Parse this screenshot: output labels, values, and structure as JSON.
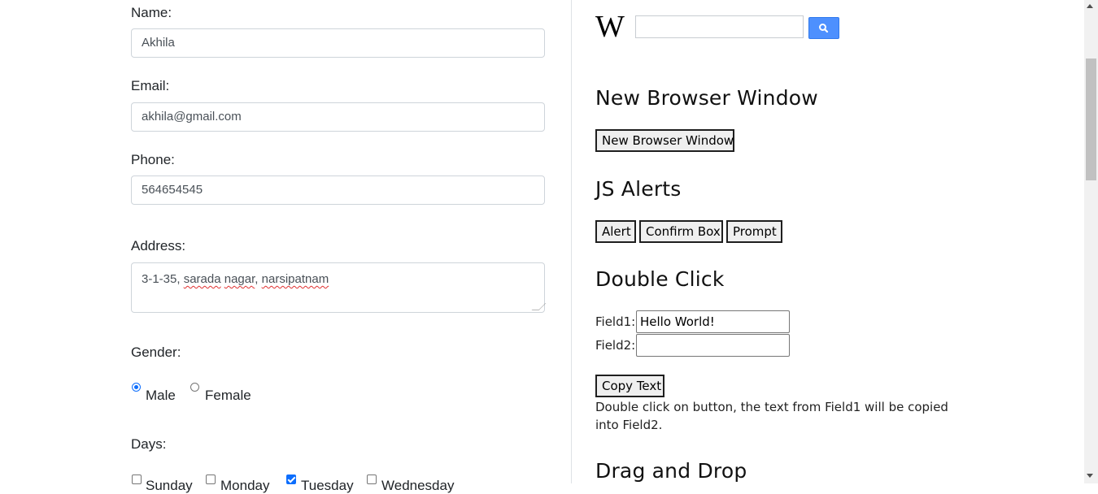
{
  "form": {
    "name_label": "Name:",
    "name_value": "Akhila",
    "email_label": "Email:",
    "email_value": "akhila@gmail.com",
    "phone_label": "Phone:",
    "phone_value": "564654545",
    "address_label": "Address:",
    "address_prefix": "3-1-35, ",
    "address_word1": "sarada",
    "address_word2": "nagar",
    "address_word3": "narsipatnam",
    "gender_label": "Gender:",
    "gender_options": [
      {
        "label": "Male",
        "selected": true
      },
      {
        "label": "Female",
        "selected": false
      }
    ],
    "days_label": "Days:",
    "days": [
      {
        "label": "Sunday",
        "checked": false
      },
      {
        "label": "Monday",
        "checked": false
      },
      {
        "label": "Tuesday",
        "checked": true
      },
      {
        "label": "Wednesday",
        "checked": false
      }
    ]
  },
  "right": {
    "wiki_logo": "W",
    "wiki_search_value": "",
    "new_window_heading": "New Browser Window",
    "new_window_button": "New Browser Window",
    "alerts_heading": "JS Alerts",
    "alert_button": "Alert",
    "confirm_button": "Confirm Box",
    "prompt_button": "Prompt",
    "double_click_heading": "Double Click",
    "field1_label": "Field1:",
    "field1_value": "Hello World!",
    "field2_label": "Field2:",
    "field2_value": "",
    "copy_button": "Copy Text",
    "double_click_desc_line1": "Double click on button, the text from Field1 will be copied",
    "double_click_desc_line2": "into Field2.",
    "drag_drop_heading": "Drag and Drop"
  },
  "colors": {
    "accent": "#0d6efd",
    "wiki_button": "#4d90fe",
    "spell_error": "#e03030"
  },
  "icons": {
    "wiki_search_button": "magnifier-icon"
  }
}
